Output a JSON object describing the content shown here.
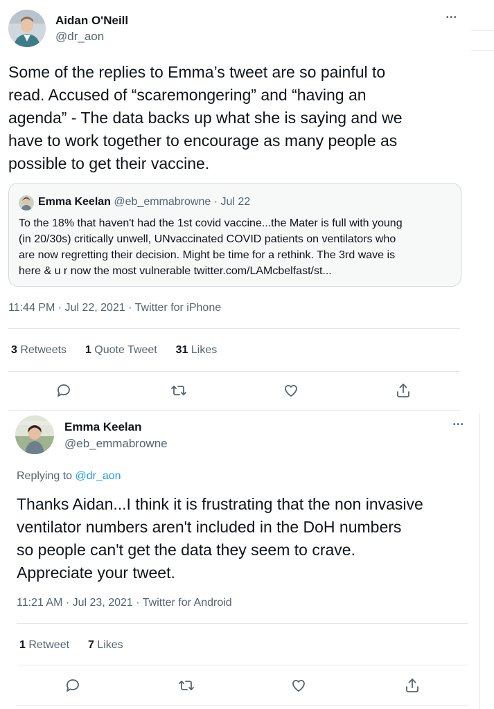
{
  "main_tweet": {
    "author_name": "Aidan O'Neill",
    "author_handle": "@dr_aon",
    "more_label": "•••",
    "text_lines": [
      "Some of the replies to Emma’s tweet are so painful to",
      "read. Accused of “scaremongering” and “having an",
      "agenda” - The data backs up what she is saying and we",
      "have to work together to encourage as many people as",
      "possible to get their vaccine."
    ],
    "quote": {
      "author_name": "Emma Keelan",
      "author_handle": "@eb_emmabrowne",
      "date": "· Jul 22",
      "text_lines": [
        "To the 18% that haven't had the 1st covid vaccine...the Mater is full with young",
        "(in 20/30s) critically unwell, UNvaccinated COVID patients on ventilators who",
        "are now regretting their decision. Might be time for a rethink. The 3rd wave is",
        "here & u r now the most vulnerable twitter.com/LAMcbelfast/st..."
      ]
    },
    "timestamp": "11:44 PM · Jul 22, 2021 · Twitter for iPhone",
    "stats": {
      "retweets_count": "3",
      "retweets_label": " Retweets",
      "quotes_count": "1",
      "quotes_label": " Quote Tweet",
      "likes_count": "31",
      "likes_label": " Likes"
    }
  },
  "reply_tweet": {
    "author_name": "Emma Keelan",
    "author_handle": "@eb_emmabrowne",
    "more_label": "•••",
    "replying_to_label": "Replying to ",
    "replying_to_handle": "@dr_aon",
    "text_lines": [
      "Thanks Aidan...I think it is frustrating that the non invasive",
      "ventilator numbers aren't included in the DoH numbers",
      "so people can't get the data they seem to crave.",
      "Appreciate your tweet."
    ],
    "timestamp": "11:21 AM · Jul 23, 2021 · Twitter for Android",
    "stats": {
      "retweets_count": "1",
      "retweets_label": " Retweet",
      "likes_count": "7",
      "likes_label": " Likes"
    }
  },
  "icons": [
    "reply-icon",
    "retweet-icon",
    "like-icon",
    "share-icon",
    "more-icon"
  ],
  "colors": {
    "text": "#0f1419",
    "secondary": "#536471",
    "link": "#1d9bf0",
    "border": "#cfd9de"
  }
}
